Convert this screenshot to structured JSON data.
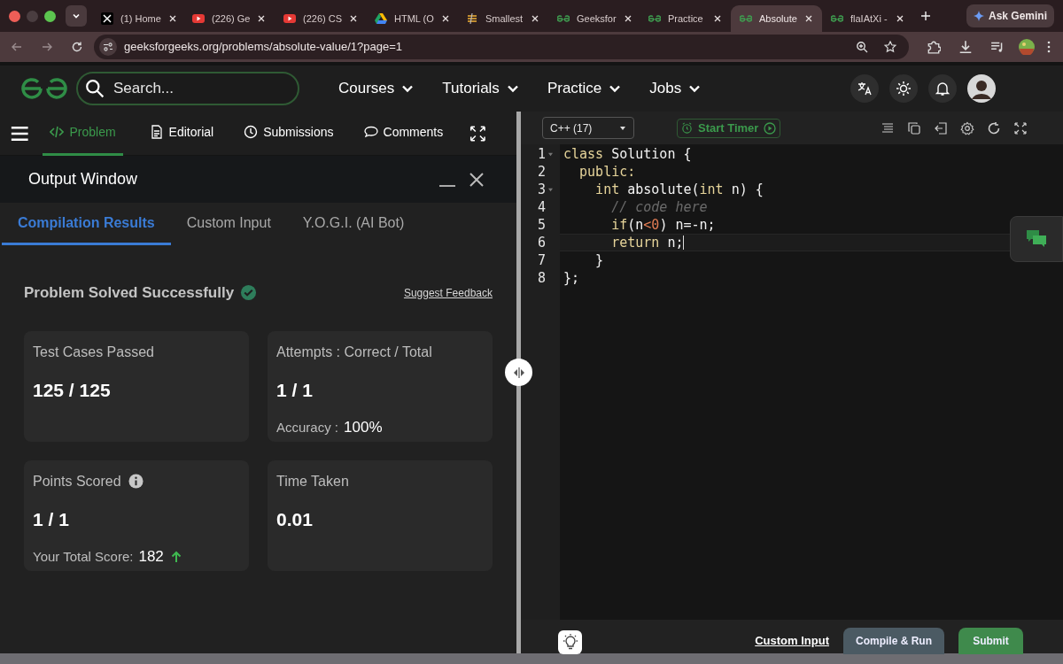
{
  "browser": {
    "tabs": [
      {
        "kind": "x",
        "title": "(1) Home",
        "selected": false
      },
      {
        "kind": "youtube",
        "title": "(226) Ge",
        "selected": false
      },
      {
        "kind": "youtube",
        "title": "(226) CS",
        "selected": false
      },
      {
        "kind": "drive",
        "title": "HTML (O",
        "selected": false
      },
      {
        "kind": "bolt",
        "title": "Smallest",
        "selected": false
      },
      {
        "kind": "gfg",
        "title": "Geeksfor",
        "selected": false
      },
      {
        "kind": "gfg",
        "title": "Practice",
        "selected": false
      },
      {
        "kind": "gfg",
        "title": "Absolute",
        "selected": true
      },
      {
        "kind": "gfg",
        "title": "flaIAtXi -",
        "selected": false
      }
    ],
    "gemini_button": "Ask Gemini",
    "url": "geeksforgeeks.org/problems/absolute-value/1?page=1"
  },
  "site_header": {
    "search_placeholder": "Search...",
    "nav": [
      "Courses",
      "Tutorials",
      "Practice",
      "Jobs"
    ]
  },
  "problem_tabs": [
    {
      "kind": "code",
      "label": "Problem",
      "selected": true
    },
    {
      "kind": "document",
      "label": "Editorial",
      "selected": false
    },
    {
      "kind": "clock",
      "label": "Submissions",
      "selected": false
    },
    {
      "kind": "comment",
      "label": "Comments",
      "selected": false
    }
  ],
  "output_window": {
    "title": "Output Window",
    "tabs": [
      {
        "label": "Compilation Results",
        "selected": true
      },
      {
        "label": "Custom Input",
        "selected": false
      },
      {
        "label": "Y.O.G.I. (AI Bot)",
        "selected": false
      }
    ],
    "status": "Problem Solved Successfully",
    "feedback_link": "Suggest Feedback",
    "cards": [
      {
        "label": "Test Cases Passed",
        "value": "125 / 125"
      },
      {
        "label": "Attempts : Correct / Total",
        "value": "1 / 1",
        "sub_label": "Accuracy :",
        "sub_value": "100%"
      },
      {
        "label": "Points Scored",
        "info": true,
        "value": "1 / 1",
        "sub_label": "Your Total Score:",
        "sub_value": "182",
        "rising": true
      },
      {
        "label": "Time Taken",
        "value": "0.01"
      }
    ]
  },
  "editor": {
    "language": "C++ (17)",
    "timer_button": "Start Timer",
    "lines": [
      {
        "number": "1",
        "foldable": true,
        "current": false,
        "tokens": [
          {
            "kind": "keyword",
            "text": "class"
          },
          {
            "kind": "plain",
            "text": " Solution {"
          }
        ]
      },
      {
        "number": "2",
        "foldable": false,
        "current": false,
        "tokens": [
          {
            "kind": "keyword",
            "text": "  public:"
          }
        ]
      },
      {
        "number": "3",
        "foldable": true,
        "current": false,
        "tokens": [
          {
            "kind": "keyword",
            "text": "    int"
          },
          {
            "kind": "plain",
            "text": " absolute("
          },
          {
            "kind": "keyword",
            "text": "int"
          },
          {
            "kind": "plain",
            "text": " n) {"
          }
        ]
      },
      {
        "number": "4",
        "foldable": false,
        "current": false,
        "tokens": [
          {
            "kind": "comment",
            "text": "      // code here"
          }
        ]
      },
      {
        "number": "5",
        "foldable": false,
        "current": false,
        "tokens": [
          {
            "kind": "keyword",
            "text": "      if"
          },
          {
            "kind": "plain",
            "text": "(n"
          },
          {
            "kind": "number",
            "text": "<0"
          },
          {
            "kind": "plain",
            "text": ") n=-n;"
          }
        ]
      },
      {
        "number": "6",
        "foldable": false,
        "current": true,
        "tokens": [
          {
            "kind": "keyword",
            "text": "      return"
          },
          {
            "kind": "plain",
            "text": " n;"
          }
        ]
      },
      {
        "number": "7",
        "foldable": false,
        "current": false,
        "tokens": [
          {
            "kind": "plain",
            "text": "    }"
          }
        ]
      },
      {
        "number": "8",
        "foldable": false,
        "current": false,
        "tokens": [
          {
            "kind": "plain",
            "text": "};"
          }
        ]
      }
    ],
    "custom_input_link": "Custom Input",
    "compile_button": "Compile & Run",
    "submit_button": "Submit"
  }
}
